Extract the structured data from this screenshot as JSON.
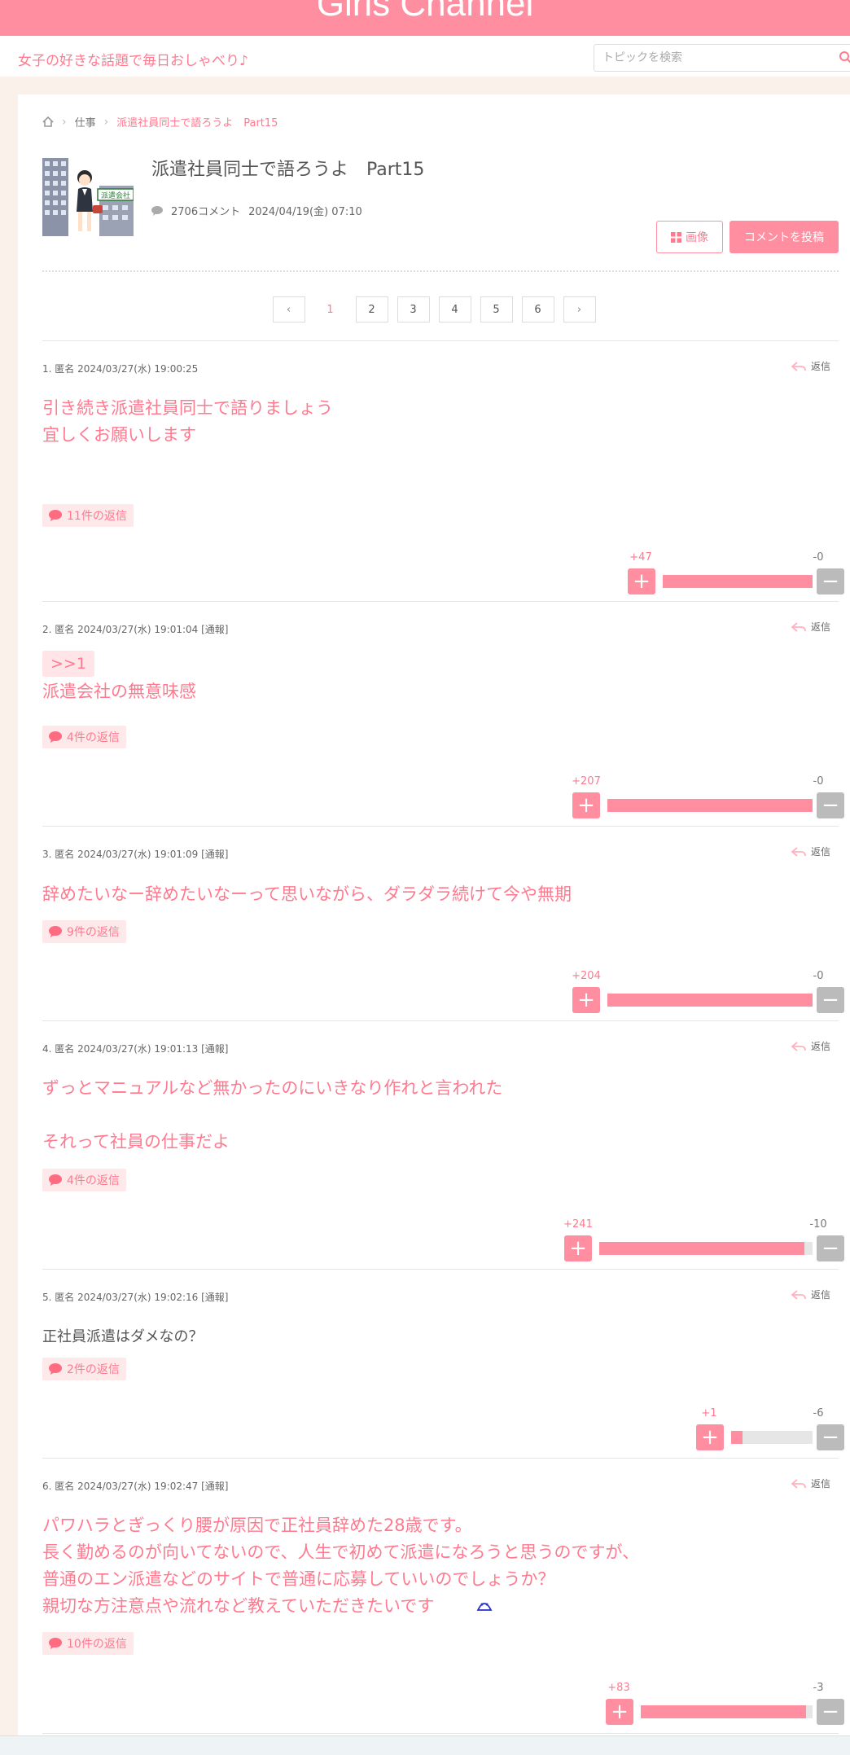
{
  "header": {
    "logo": "Girls Channel",
    "tagline": "女子の好きな話題で毎日おしゃべり♪",
    "search_placeholder": "トピックを検索"
  },
  "breadcrumb": {
    "category": "仕事",
    "current": "派遣社員同士で語ろうよ　Part15"
  },
  "topic": {
    "title": "派遣社員同士で語ろうよ　Part15",
    "thumbnail_sign": "派遣会社",
    "comment_count": "2706コメント",
    "date": "2024/04/19(金) 07:10",
    "image_button": "画像",
    "post_button": "コメントを投稿"
  },
  "pagination": {
    "prev": "‹",
    "next": "›",
    "pages": [
      "1",
      "2",
      "3",
      "4",
      "5",
      "6"
    ],
    "current": "1"
  },
  "reply_label": "返信",
  "comments": [
    {
      "header": "1. 匿名 2024/03/27(水) 19:00:25",
      "anchor": "",
      "text": "引き続き派遣社員同士で語りましょう\n宜しくお願いします",
      "replies": "11件の返信",
      "plus": "+47",
      "minus": "-0",
      "plus_ratio": 1.0
    },
    {
      "header": "2. 匿名 2024/03/27(水) 19:01:04 [通報]",
      "anchor": ">>1",
      "text": "派遣会社の無意味感",
      "replies": "4件の返信",
      "plus": "+207",
      "minus": "-0",
      "plus_ratio": 1.0
    },
    {
      "header": "3. 匿名 2024/03/27(水) 19:01:09 [通報]",
      "anchor": "",
      "text": "辞めたいなー辞めたいなーって思いながら、ダラダラ続けて今や無期",
      "replies": "9件の返信",
      "plus": "+204",
      "minus": "-0",
      "plus_ratio": 1.0
    },
    {
      "header": "4. 匿名 2024/03/27(水) 19:01:13 [通報]",
      "anchor": "",
      "text": "ずっとマニュアルなど無かったのにいきなり作れと言われた\n\nそれって社員の仕事だよ",
      "replies": "4件の返信",
      "plus": "+241",
      "minus": "-10",
      "plus_ratio": 0.96
    },
    {
      "header": "5. 匿名 2024/03/27(水) 19:02:16 [通報]",
      "anchor": "",
      "text": "正社員派遣はダメなの？",
      "replies": "2件の返信",
      "plus": "+1",
      "minus": "-6",
      "plus_ratio": 0.14
    },
    {
      "header": "6. 匿名 2024/03/27(水) 19:02:47 [通報]",
      "anchor": "",
      "text": "パワハラとぎっくり腰が原因で正社員辞めた28歳です。\n長く勤めるのが向いてないので、人生で初めて派遣になろうと思うのですが、\n普通のエン派遣などのサイトで普通に応募していいのでしょうか？\n親切な方注意点や流れなど教えていただきたいです",
      "replies": "10件の返信",
      "plus": "+83",
      "minus": "-3",
      "plus_ratio": 0.96
    }
  ]
}
